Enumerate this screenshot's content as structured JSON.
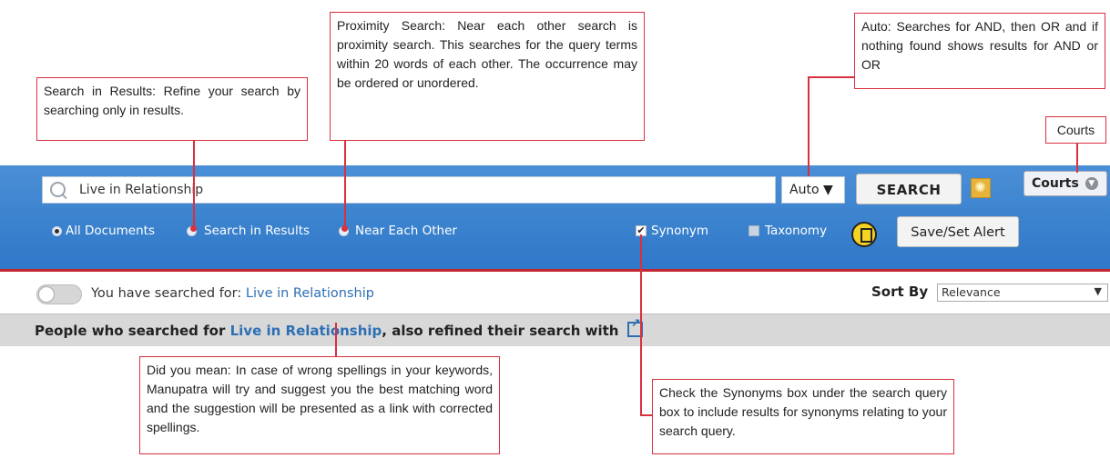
{
  "callouts": {
    "search_in_results": "Search in Results: Refine your search by searching only in results.",
    "proximity": "Proximity Search: Near each other search is proximity search. This searches for the query terms within 20 words of each other. The occurrence may be ordered or unordered.",
    "auto": "Auto: Searches for AND, then OR and if nothing found shows results for AND or OR",
    "courts": "Courts",
    "did_you_mean": "Did you mean: In case of wrong spellings in your keywords, Manupatra will try and suggest you the best matching word and the suggestion will be presented as a link with corrected spellings.",
    "synonyms": "Check the Synonyms box under the search query box to include results for synonyms relating to your search query."
  },
  "search": {
    "query": "Live in Relationship",
    "mode": "Auto ▼",
    "search_button": "SEARCH",
    "courts_button": "Courts"
  },
  "options": {
    "all_documents": "All Documents",
    "search_in_results": "Search in Results",
    "near_each_other": "Near Each Other",
    "selected": "All Documents",
    "synonym": "Synonym",
    "synonym_checked": true,
    "taxonomy": "Taxonomy",
    "taxonomy_checked": false,
    "save_alert": "Save/Set Alert"
  },
  "results": {
    "searched_prefix": "You have searched for:",
    "searched_query": "Live in Relationship",
    "sort_label": "Sort By",
    "sort_value": "Relevance",
    "refine_prefix": "People who searched for",
    "refine_query": "Live in Relationship",
    "refine_suffix": ", also refined their search with"
  },
  "colors": {
    "toolbar_blue": "#2f78c8",
    "callout_border": "#d9303f",
    "link_blue": "#2d6fb3"
  }
}
